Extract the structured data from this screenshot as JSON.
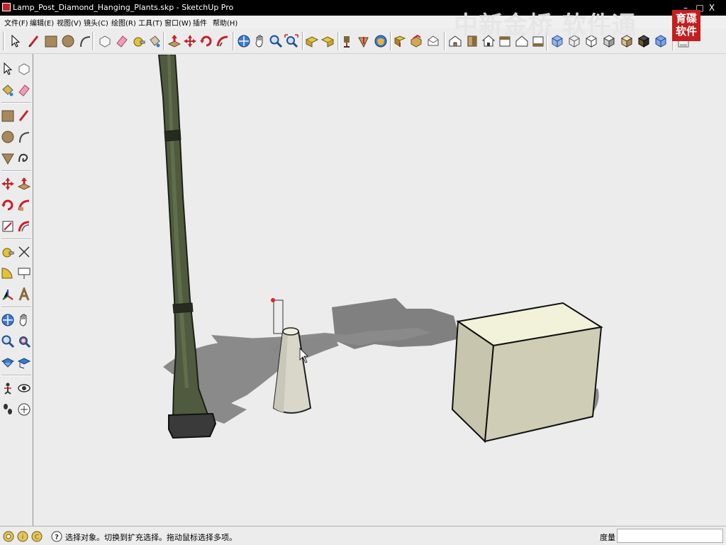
{
  "window": {
    "title": "Lamp_Post_Diamond_Hanging_Plants.skp - SketchUp Pro",
    "minimize_glyph": "–",
    "maximize_glyph": "□",
    "close_glyph": "X"
  },
  "menubar": {
    "items": [
      "文件(F)",
      "编辑(E)",
      "视图(V)",
      "镜头(C)",
      "绘图(R)",
      "工具(T)",
      "窗口(W)",
      "插件",
      "帮助(H)"
    ]
  },
  "watermark": {
    "text": "中新金桥 软件通",
    "logo_top": "育碟",
    "logo_bottom": "软件"
  },
  "main_toolbar": {
    "icons": [
      "select-tool-icon",
      "line-tool-icon",
      "rectangle-tool-icon",
      "circle-tool-icon",
      "arc-tool-icon",
      "make-component-icon",
      "eraser-tool-icon",
      "tape-measure-icon",
      "paint-bucket-icon",
      "push-pull-icon",
      "move-tool-icon",
      "rotate-tool-icon",
      "follow-me-icon",
      "orbit-tool-icon",
      "pan-tool-icon",
      "zoom-tool-icon",
      "zoom-extents-icon",
      "previous-view-icon",
      "next-view-icon",
      "position-camera-icon",
      "walk-tool-icon",
      "get-models-icon",
      "share-model-icon",
      "share-component-icon",
      "iso-view-icon",
      "top-view-icon",
      "front-view-icon",
      "right-view-icon",
      "back-view-icon",
      "left-view-icon",
      "xray-style-icon",
      "wireframe-style-icon",
      "hidden-line-style-icon",
      "shaded-style-icon",
      "shaded-texture-style-icon",
      "monochrome-style-icon",
      "section-plane-icon"
    ]
  },
  "left_toolbar": {
    "icons": [
      "select-tool-icon",
      "make-component-icon",
      "paint-bucket-icon",
      "eraser-tool-icon",
      "rectangle-tool-icon",
      "line-tool-icon",
      "circle-tool-icon",
      "arc-tool-icon",
      "polygon-tool-icon",
      "freehand-tool-icon",
      "move-tool-icon",
      "push-pull-icon",
      "rotate-tool-icon",
      "follow-me-icon",
      "scale-tool-icon",
      "offset-tool-icon",
      "tape-measure-icon",
      "dimension-tool-icon",
      "protractor-tool-icon",
      "text-tool-icon",
      "axes-tool-icon",
      "3d-text-tool-icon",
      "orbit-tool-icon",
      "pan-tool-icon",
      "zoom-tool-icon",
      "zoom-window-icon",
      "zoom-extents-icon",
      "previous-view-icon",
      "position-camera-icon",
      "look-around-icon",
      "walk-tool-icon",
      "section-plane-icon"
    ]
  },
  "statusbar": {
    "status_text": "选择对象。切换到扩充选择。拖动鼠标选择多项。",
    "measure_label": "度量",
    "measure_value": ""
  },
  "scene": {
    "objects": [
      "lamp-post",
      "cone",
      "box"
    ],
    "background_color": "#ececec",
    "post_color": "#4f5a3e",
    "cone_color": "#d8d7c9",
    "box_top_color": "#f2f1da",
    "box_side_color": "#cfcdb5",
    "shadow_color": "#7f7f7f"
  },
  "colors": {
    "titlebar": "#000000",
    "panel": "#ececec",
    "accent_red": "#c8202a"
  }
}
